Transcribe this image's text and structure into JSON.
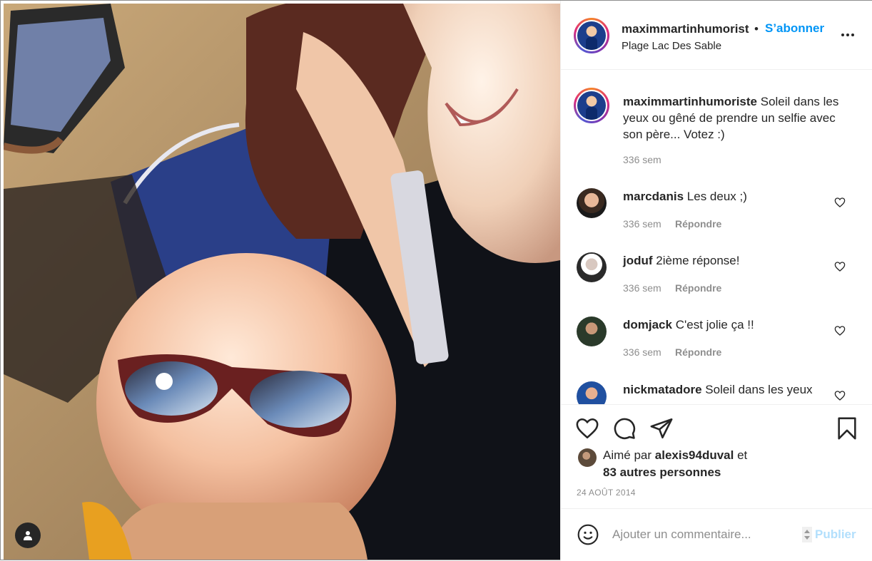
{
  "post": {
    "author": "maximmartinhumoriste",
    "header_author": "maximmartinhumorist",
    "separator": "•",
    "follow_label": "S’abonner",
    "location": "Plage Lac Des Sable",
    "more_icon": "more-options-icon",
    "photo_alt": "Selfie photo on the beach",
    "user_tag_icon": "user-tag-icon"
  },
  "caption": {
    "username": "maximmartinhumoriste",
    "text": "Soleil dans les yeux ou gêné de prendre un selfie avec son père... Votez :)",
    "time": "336 sem"
  },
  "comments": [
    {
      "username": "marcdanis",
      "text": "Les deux ;)",
      "time": "336 sem",
      "reply_label": "Répondre"
    },
    {
      "username": "joduf",
      "text": "2ième réponse!",
      "time": "336 sem",
      "reply_label": "Répondre"
    },
    {
      "username": "domjack",
      "text": "C'est jolie ça !!",
      "time": "336 sem",
      "reply_label": "Répondre"
    },
    {
      "username": "nickmatadore",
      "text": "Soleil dans les yeux",
      "time": "",
      "reply_label": ""
    }
  ],
  "actions": {
    "icons": [
      "heart-icon",
      "comment-icon",
      "share-icon",
      "bookmark-icon"
    ]
  },
  "likes": {
    "prefix": "Aimé par",
    "liker": "alexis94duval",
    "conjunction": "et",
    "others": "83 autres personnes"
  },
  "date": "24 AOÛT 2014",
  "add_comment": {
    "placeholder": "Ajouter un commentaire...",
    "publish_label": "Publier"
  },
  "colors": {
    "accent": "#0095f6",
    "publish_disabled": "#b2dffc",
    "text": "#262626",
    "muted": "#8e8e8e"
  }
}
